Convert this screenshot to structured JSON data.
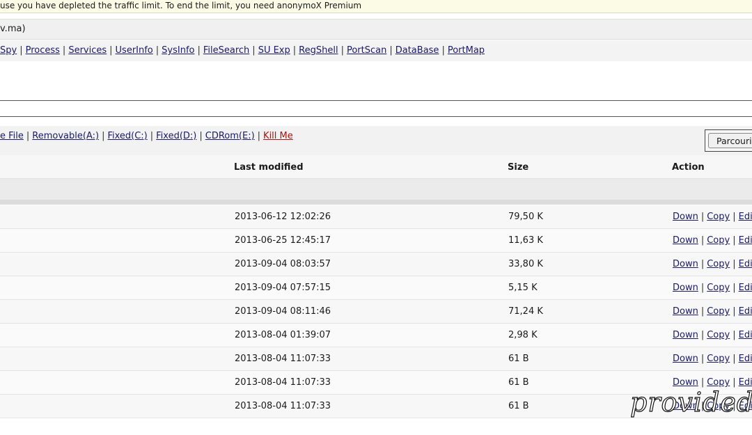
{
  "notice": "use you have depleted the traffic limit. To end the limit, you need anonymoX Premium",
  "host": "v.ma)",
  "toolbar": {
    "items": [
      "Spy",
      "Process",
      "Services",
      "UserInfo",
      "SysInfo",
      "FileSearch",
      "SU Exp",
      "RegShell",
      "PortScan",
      "DataBase",
      "PortMap"
    ]
  },
  "drives": {
    "items": [
      "e File",
      "Removable(A:)",
      "Fixed(C:)",
      "Fixed(D:)",
      "CDRom(E:)"
    ],
    "kill": "Kill Me",
    "browse_button": "Parcourir"
  },
  "table": {
    "headers": {
      "last_modified": "Last modified",
      "size": "Size",
      "action": "Action"
    },
    "actions": {
      "down": "Down",
      "copy": "Copy",
      "edit": "Edit"
    },
    "rows": [
      {
        "date": "2013-06-12 12:02:26",
        "size": "79,50 K"
      },
      {
        "date": "2013-06-25 12:45:17",
        "size": "11,63 K"
      },
      {
        "date": "2013-09-04 08:03:57",
        "size": "33,80 K"
      },
      {
        "date": "2013-09-04 07:57:15",
        "size": "5,15 K"
      },
      {
        "date": "2013-09-04 08:11:46",
        "size": "71,24 K"
      },
      {
        "date": "2013-08-04 01:39:07",
        "size": "2,98 K"
      },
      {
        "date": "2013-08-04 11:07:33",
        "size": "61 B"
      },
      {
        "date": "2013-08-04 11:07:33",
        "size": "61 B"
      },
      {
        "date": "2013-08-04 11:07:33",
        "size": "61 B"
      }
    ]
  },
  "watermark": "provided-b"
}
